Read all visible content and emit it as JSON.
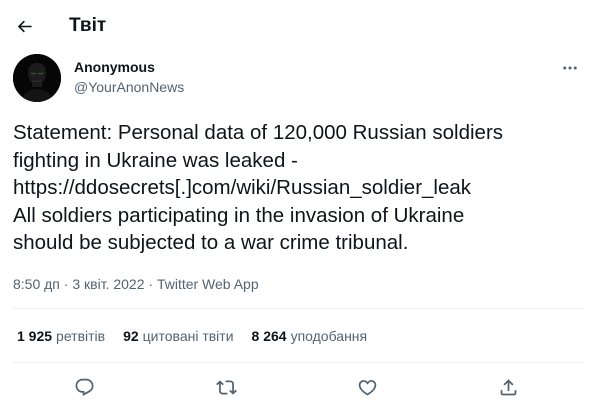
{
  "header": {
    "title": "Твіт",
    "back_icon": "arrow-left-icon"
  },
  "author": {
    "name": "Anonymous",
    "handle": "@YourAnonNews",
    "avatar": "anonymous-mask-avatar",
    "more_icon": "more-dots-icon"
  },
  "tweet": {
    "text": "Statement: Personal data of 120,000 Russian soldiers\nfighting in Ukraine was leaked -\nhttps://ddosecrets[.]com/wiki/Russian_soldier_leak\nAll soldiers participating in the invasion of Ukraine\nshould be subjected to a war crime tribunal."
  },
  "meta": {
    "time": "8:50 дп",
    "separator": "·",
    "date": "3 квіт. 2022",
    "source": "Twitter Web App"
  },
  "stats": {
    "retweets_count": "1 925",
    "retweets_label": "ретвітів",
    "quotes_count": "92",
    "quotes_label": "цитовані твіти",
    "likes_count": "8 264",
    "likes_label": "уподобання"
  },
  "actions": {
    "icons": [
      "reply-icon",
      "retweet-icon",
      "like-icon",
      "share-icon"
    ]
  },
  "colors": {
    "text": "#0f1419",
    "secondary": "#536471",
    "divider": "#eff3f4",
    "background": "#ffffff"
  }
}
